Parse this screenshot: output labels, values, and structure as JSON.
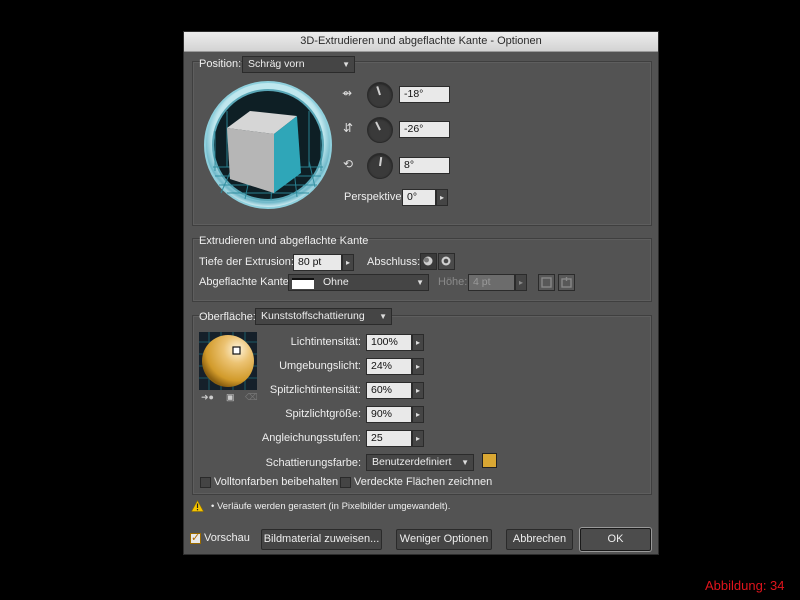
{
  "dialog": {
    "title": "3D-Extrudieren und abgeflachte Kante - Optionen"
  },
  "position": {
    "label": "Position:",
    "preset": "Schräg vorn",
    "rot_x": "-18°",
    "rot_y": "-26°",
    "rot_z": "8°",
    "perspective_label": "Perspektive:",
    "perspective_value": "0°"
  },
  "extrude": {
    "section_title": "Extrudieren und abgeflachte Kante",
    "depth_label": "Tiefe der Extrusion:",
    "depth_value": "80 pt",
    "cap_label": "Abschluss:",
    "bevel_label": "Abgeflachte Kante:",
    "bevel_value": "Ohne",
    "height_label": "Höhe:",
    "height_value": "4 pt"
  },
  "surface": {
    "label": "Oberfläche:",
    "value": "Kunststoffschattierung",
    "light_intensity_label": "Lichtintensität:",
    "light_intensity_value": "100%",
    "ambient_label": "Umgebungslicht:",
    "ambient_value": "24%",
    "highlight_intensity_label": "Spitzlichtintensität:",
    "highlight_intensity_value": "60%",
    "highlight_size_label": "Spitzlichtgröße:",
    "highlight_size_value": "90%",
    "blend_steps_label": "Angleichungsstufen:",
    "blend_steps_value": "25",
    "shading_color_label": "Schattierungsfarbe:",
    "shading_color_value": "Benutzerdefiniert",
    "shading_color_hex": "#d9a733",
    "preserve_spot_label": "Volltonfarben beibehalten",
    "draw_hidden_label": "Verdeckte Flächen zeichnen"
  },
  "warning": {
    "text": "• Verläufe werden gerastert (in Pixelbilder umgewandelt)."
  },
  "footer": {
    "preview_label": "Vorschau",
    "map_art_label": "Bildmaterial zuweisen...",
    "fewer_options_label": "Weniger Optionen",
    "cancel_label": "Abbrechen",
    "ok_label": "OK"
  },
  "caption": "Abbildung: 34",
  "colors": {
    "cube_front": "#2fa6b8",
    "caption": "#e0141c",
    "panel": "#535353"
  }
}
